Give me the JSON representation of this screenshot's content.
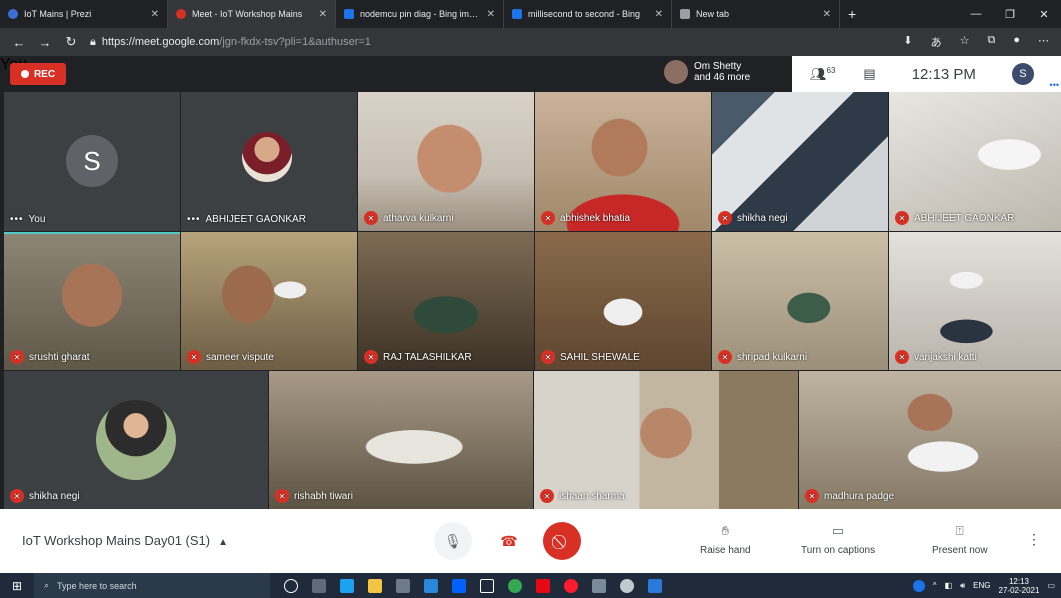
{
  "browser": {
    "tabs": [
      {
        "title": "IoT Mains | Prezi",
        "color": "#3c6fd6",
        "active": false
      },
      {
        "title": "Meet - IoT Workshop Mains",
        "color": "#d93025",
        "active": true
      },
      {
        "title": "nodemcu pin diag - Bing images",
        "color": "#1a73e8",
        "active": false
      },
      {
        "title": "millisecond to second - Bing",
        "color": "#1a73e8",
        "active": false
      },
      {
        "title": "New tab",
        "color": "#9aa0a6",
        "active": false
      }
    ],
    "url_host": "https://meet.google.com",
    "url_path": "/jgn-fkdx-tsv?pli=1&authuser=1"
  },
  "meet": {
    "rec_label": "REC",
    "presenter_line1": "Om Shetty",
    "presenter_line2": "and 46 more",
    "people_count": "63",
    "clock": "12:13 PM",
    "self_initial": "S",
    "self_label": "You",
    "meeting_title": "IoT Workshop Mains Day01 (S1)",
    "raise_hand": "Raise hand",
    "captions": "Turn on captions",
    "present": "Present now"
  },
  "tiles": [
    {
      "name": "You",
      "kind": "self"
    },
    {
      "name": "ABHIJEET GAONKAR",
      "kind": "photo"
    },
    {
      "name": "atharva kulkarni",
      "kind": "video"
    },
    {
      "name": "abhishek bhatia",
      "kind": "video"
    },
    {
      "name": "shikha negi",
      "kind": "video"
    },
    {
      "name": "ABHIJEET GAONKAR",
      "kind": "video"
    },
    {
      "name": "srushti gharat",
      "kind": "video"
    },
    {
      "name": "sameer vispute",
      "kind": "video"
    },
    {
      "name": "RAJ TALASHILKAR",
      "kind": "video"
    },
    {
      "name": "SAHIL SHEWALE",
      "kind": "video"
    },
    {
      "name": "shripad kulkarni",
      "kind": "video"
    },
    {
      "name": "varijakshi katti",
      "kind": "video"
    },
    {
      "name": "shikha negi",
      "kind": "photo"
    },
    {
      "name": "rishabh tiwari",
      "kind": "video"
    },
    {
      "name": "ishaan sharma",
      "kind": "video"
    },
    {
      "name": "madhura padge",
      "kind": "video"
    }
  ],
  "taskbar": {
    "search_placeholder": "Type here to search",
    "lang": "ENG",
    "time": "12:13",
    "date": "27-02-2021"
  }
}
